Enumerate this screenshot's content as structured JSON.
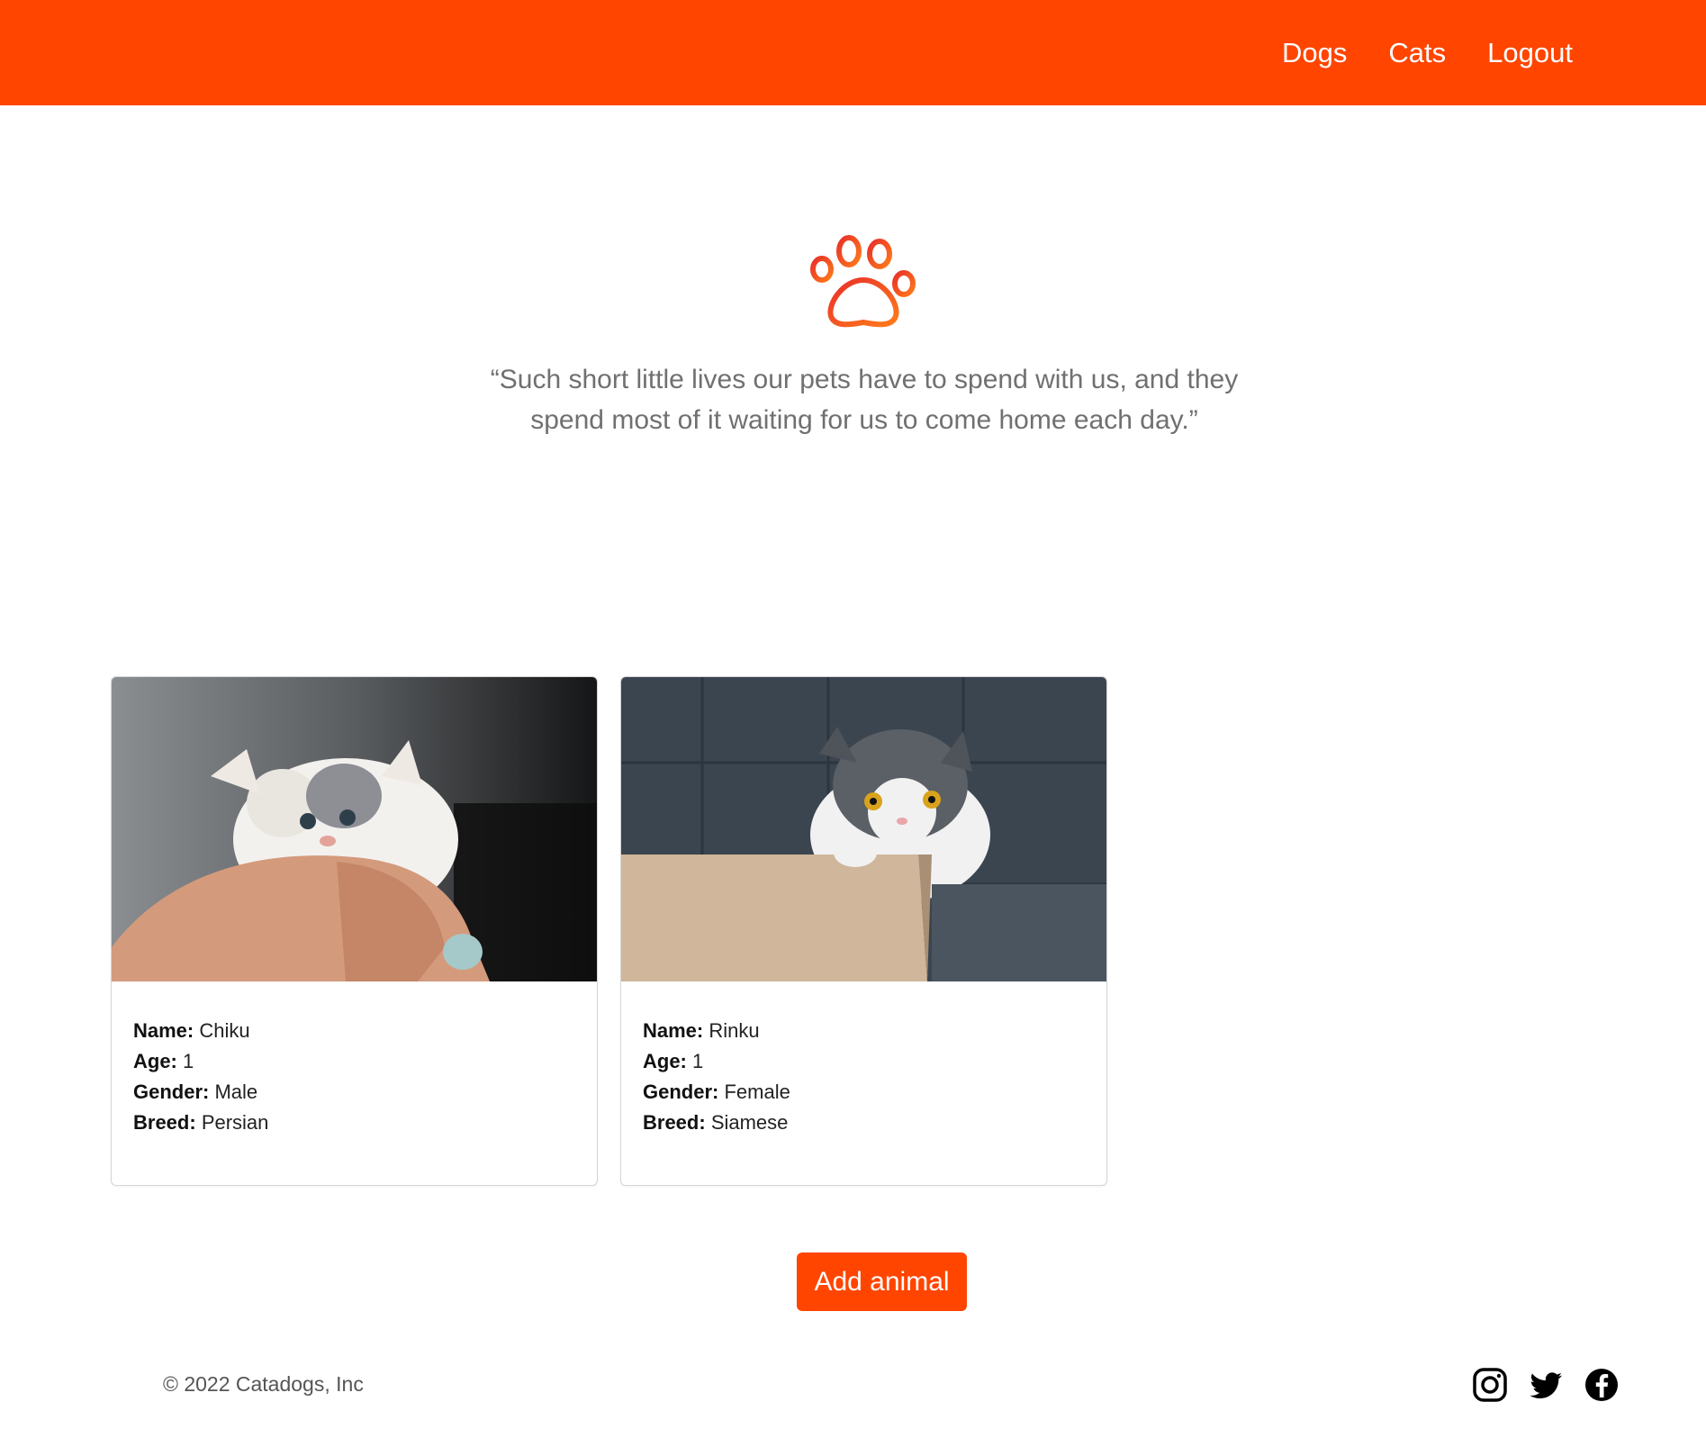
{
  "colors": {
    "brand": "#ff4500",
    "text_muted": "#707070"
  },
  "nav": {
    "items": [
      {
        "label": "Dogs"
      },
      {
        "label": "Cats"
      },
      {
        "label": "Logout"
      }
    ]
  },
  "hero": {
    "icon": "paw-icon",
    "quote": "“Such short little lives our pets have to spend with us, and they spend most of it waiting for us to come home each day.”"
  },
  "animals": [
    {
      "image_icon": "kitten-photo",
      "name_label": "Name:",
      "name": "Chiku",
      "age_label": "Age:",
      "age": "1",
      "gender_label": "Gender:",
      "gender": "Male",
      "breed_label": "Breed:",
      "breed": "Persian"
    },
    {
      "image_icon": "cat-in-box-photo",
      "name_label": "Name:",
      "name": "Rinku",
      "age_label": "Age:",
      "age": "1",
      "gender_label": "Gender:",
      "gender": "Female",
      "breed_label": "Breed:",
      "breed": "Siamese"
    }
  ],
  "actions": {
    "add_label": "Add animal"
  },
  "footer": {
    "copyright": "© 2022 Catadogs, Inc",
    "socials": [
      "instagram-icon",
      "twitter-icon",
      "facebook-icon"
    ]
  }
}
